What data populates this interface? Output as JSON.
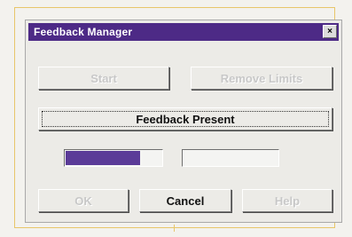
{
  "dialog": {
    "title": "Feedback Manager",
    "close_glyph": "×"
  },
  "buttons": {
    "start": "Start",
    "remove_limits": "Remove Limits",
    "feedback_present": "Feedback Present",
    "ok": "OK",
    "cancel": "Cancel",
    "help": "Help"
  },
  "progress": {
    "value_fraction": 0.78
  },
  "colors": {
    "titlebar": "#4d2a86",
    "progress_fill": "#5b3b98",
    "frame_highlight": "#e8c66a"
  }
}
